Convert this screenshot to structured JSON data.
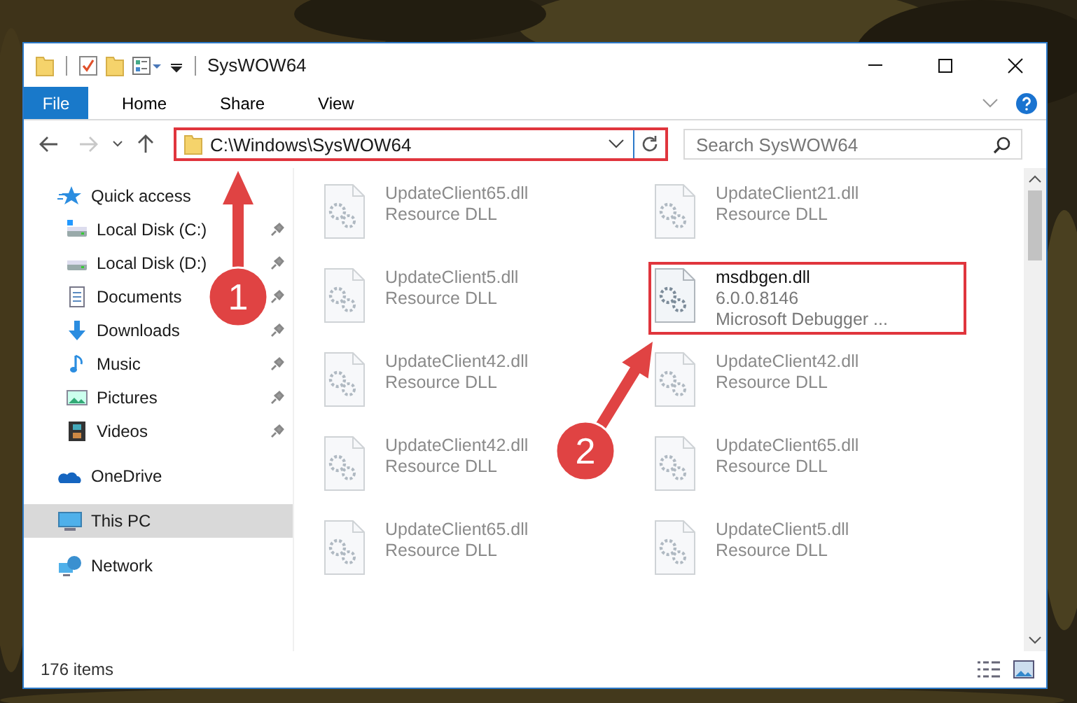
{
  "window": {
    "title": "SysWOW64"
  },
  "ribbon_tabs": [
    {
      "label": "File",
      "kind": "menu"
    },
    {
      "label": "Home",
      "kind": "tab"
    },
    {
      "label": "Share",
      "kind": "tab"
    },
    {
      "label": "View",
      "kind": "tab"
    }
  ],
  "address_bar": {
    "path": "C:\\Windows\\SysWOW64",
    "highlighted": true
  },
  "search": {
    "placeholder": "Search SysWOW64"
  },
  "sidebar": {
    "items": [
      {
        "label": "Quick access",
        "selected": false,
        "children": [
          {
            "label": "Local Disk (C:)",
            "pinned": true,
            "selected": false
          },
          {
            "label": "Local Disk (D:)",
            "pinned": true,
            "selected": false
          },
          {
            "label": "Documents",
            "pinned": true,
            "selected": false
          },
          {
            "label": "Downloads",
            "pinned": true,
            "selected": false
          },
          {
            "label": "Music",
            "pinned": true,
            "selected": false
          },
          {
            "label": "Pictures",
            "pinned": true,
            "selected": false
          },
          {
            "label": "Videos",
            "pinned": true,
            "selected": false
          }
        ]
      },
      {
        "label": "OneDrive",
        "selected": false
      },
      {
        "label": "This PC",
        "selected": true
      },
      {
        "label": "Network",
        "selected": false
      }
    ]
  },
  "files": [
    {
      "name": "UpdateClient65.dll",
      "details": [
        "Resource DLL"
      ],
      "blurred": true,
      "highlighted": false
    },
    {
      "name": "UpdateClient21.dll",
      "details": [
        "Resource DLL"
      ],
      "blurred": true,
      "highlighted": false
    },
    {
      "name": "UpdateClient5.dll",
      "details": [
        "Resource DLL"
      ],
      "blurred": true,
      "highlighted": false
    },
    {
      "name": "msdbgen.dll",
      "details": [
        "6.0.0.8146",
        "Microsoft Debugger ..."
      ],
      "blurred": false,
      "highlighted": true
    },
    {
      "name": "UpdateClient42.dll",
      "details": [
        "Resource DLL"
      ],
      "blurred": true,
      "highlighted": false
    },
    {
      "name": "UpdateClient42.dll",
      "details": [
        "Resource DLL"
      ],
      "blurred": true,
      "highlighted": false
    },
    {
      "name": "UpdateClient42.dll",
      "details": [
        "Resource DLL"
      ],
      "blurred": true,
      "highlighted": false
    },
    {
      "name": "UpdateClient65.dll",
      "details": [
        "Resource DLL"
      ],
      "blurred": true,
      "highlighted": false
    },
    {
      "name": "UpdateClient65.dll",
      "details": [
        "Resource DLL"
      ],
      "blurred": true,
      "highlighted": false
    },
    {
      "name": "UpdateClient5.dll",
      "details": [
        "Resource DLL"
      ],
      "blurred": true,
      "highlighted": false
    }
  ],
  "status_bar": {
    "item_count": "176 items"
  },
  "annotations": [
    {
      "label": "1"
    },
    {
      "label": "2"
    }
  ]
}
